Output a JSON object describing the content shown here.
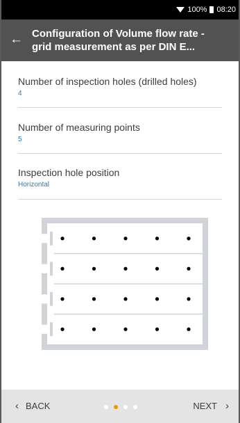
{
  "status_bar": {
    "battery": "100%",
    "time": "08:20"
  },
  "header": {
    "title": "Configuration of Volume flow rate -\ngrid measurement as per DIN E..."
  },
  "settings": [
    {
      "label": "Number of inspection holes (drilled holes)",
      "value": "4"
    },
    {
      "label": "Number of measuring points",
      "value": "5"
    },
    {
      "label": "Inspection hole position",
      "value": "Horizontal"
    }
  ],
  "grid": {
    "holes": 4,
    "points": 5,
    "orientation": "Horizontal"
  },
  "nav": {
    "back_label": "BACK",
    "next_label": "NEXT",
    "page_count": 4,
    "active_page": 2
  },
  "colors": {
    "accent": "#f39200",
    "value_text": "#2a7aa8",
    "header_bg": "#525252",
    "duct": "#d0d4d8"
  },
  "icons": {
    "back": "back-arrow-icon",
    "wifi": "wifi-icon",
    "battery": "battery-icon",
    "prev": "chevron-left-icon",
    "next": "chevron-right-icon"
  }
}
